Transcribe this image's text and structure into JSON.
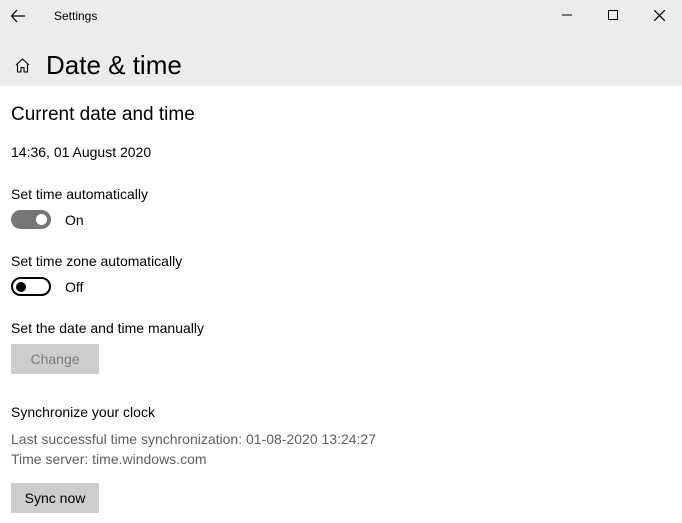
{
  "titlebar": {
    "app_name": "Settings"
  },
  "header": {
    "page_title": "Date & time"
  },
  "main": {
    "section_heading": "Current date and time",
    "current_datetime": "14:36, 01 August 2020",
    "set_time_auto": {
      "label": "Set time automatically",
      "state": "on",
      "state_text": "On"
    },
    "set_tz_auto": {
      "label": "Set time zone automatically",
      "state": "off",
      "state_text": "Off"
    },
    "manual": {
      "label": "Set the date and time manually",
      "button": "Change"
    },
    "sync": {
      "heading": "Synchronize your clock",
      "last_sync": "Last successful time synchronization: 01-08-2020 13:24:27",
      "server": "Time server: time.windows.com",
      "button": "Sync now"
    }
  }
}
